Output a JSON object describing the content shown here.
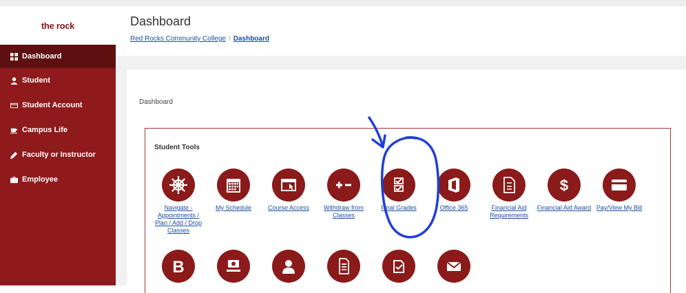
{
  "brand": {
    "name": "the rock"
  },
  "sidebar": {
    "items": [
      {
        "label": "Dashboard",
        "icon": "grid-icon",
        "active": true
      },
      {
        "label": "Student",
        "icon": "user-icon"
      },
      {
        "label": "Student Account",
        "icon": "card-icon"
      },
      {
        "label": "Campus Life",
        "icon": "coffee-icon"
      },
      {
        "label": "Faculty or Instructor",
        "icon": "pencil-icon"
      },
      {
        "label": "Employee",
        "icon": "briefcase-icon"
      }
    ]
  },
  "header": {
    "title": "Dashboard",
    "breadcrumb": {
      "root": "Red Rocks Community College",
      "separator": "/",
      "current": "Dashboard"
    }
  },
  "content": {
    "label": "Dashboard"
  },
  "tools": {
    "title": "Student Tools",
    "row1": [
      {
        "label": "Navigate - Appointments / Plan / Add / Drop Classes",
        "icon": "ship-wheel-icon"
      },
      {
        "label": "My Schedule",
        "icon": "calendar-icon"
      },
      {
        "label": "Course Access",
        "icon": "browser-window-icon"
      },
      {
        "label": "Withdraw from Classes",
        "icon": "plus-minus-icon"
      },
      {
        "label": "Final Grades",
        "icon": "checklist-icon"
      },
      {
        "label": "Office 365",
        "icon": "office-icon"
      },
      {
        "label": "Financial Aid Requirements",
        "icon": "document-icon"
      },
      {
        "label": "Financial Aid Award",
        "icon": "dollar-icon"
      },
      {
        "label": "Pay/View My Bill",
        "icon": "credit-card-icon"
      }
    ],
    "row2": [
      {
        "icon": "b-logo-icon"
      },
      {
        "icon": "money-hand-icon"
      },
      {
        "icon": "person-icon"
      },
      {
        "icon": "file-icon"
      },
      {
        "icon": "edit-check-icon"
      },
      {
        "icon": "envelope-icon"
      }
    ]
  },
  "colors": {
    "primary": "#8e1a1c",
    "active": "#5e1010",
    "link": "#1a4ea0",
    "annotation": "#1f3fd6"
  }
}
